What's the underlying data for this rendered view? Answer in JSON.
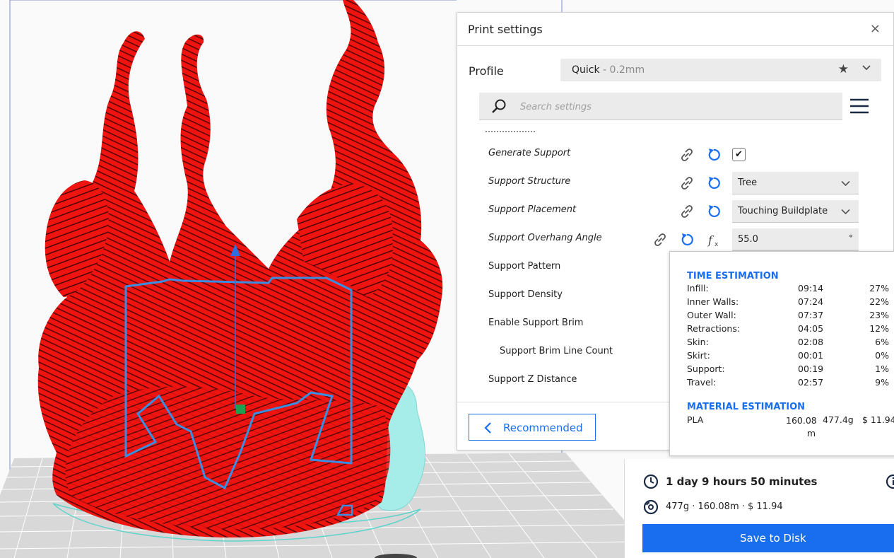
{
  "panel": {
    "title": "Print settings",
    "close_icon": "×",
    "profile_label": "Profile",
    "profile_name": "Quick",
    "profile_layer_height": " - 0.2mm",
    "search_placeholder": "Search settings",
    "settings": [
      {
        "label": "Generate Support",
        "italic": true,
        "control": "checkbox",
        "checked": true,
        "check_glyph": "✔"
      },
      {
        "label": "Support Structure",
        "italic": true,
        "control": "dropdown",
        "value": "Tree"
      },
      {
        "label": "Support Placement",
        "italic": true,
        "control": "dropdown",
        "value": "Touching Buildplate"
      },
      {
        "label": "Support Overhang Angle",
        "italic": true,
        "control": "number",
        "value": "55.0",
        "unit": "°"
      },
      {
        "label": "Support Pattern",
        "italic": false
      },
      {
        "label": "Support Density",
        "italic": false
      },
      {
        "label": "Enable Support Brim",
        "italic": false
      },
      {
        "label": "Support Brim Line Count",
        "italic": false,
        "indent": true
      },
      {
        "label": "Support Z Distance",
        "italic": false
      }
    ],
    "recommended_label": "Recommended"
  },
  "estimation": {
    "time_heading": "TIME ESTIMATION",
    "time_rows": [
      {
        "name": "Infill:",
        "time": "09:14",
        "pct": "27%"
      },
      {
        "name": "Inner Walls:",
        "time": "07:24",
        "pct": "22%"
      },
      {
        "name": "Outer Wall:",
        "time": "07:37",
        "pct": "23%"
      },
      {
        "name": "Retractions:",
        "time": "04:05",
        "pct": "12%"
      },
      {
        "name": "Skin:",
        "time": "02:08",
        "pct": "6%"
      },
      {
        "name": "Skirt:",
        "time": "00:01",
        "pct": "0%"
      },
      {
        "name": "Support:",
        "time": "00:19",
        "pct": "1%"
      },
      {
        "name": "Travel:",
        "time": "02:57",
        "pct": "9%"
      }
    ],
    "material_heading": "MATERIAL ESTIMATION",
    "material": {
      "name": "PLA",
      "length": "160.08 m",
      "weight": "477.4g",
      "cost": "$ 11.94"
    }
  },
  "summary": {
    "print_time": "1 day 9 hours 50 minutes",
    "material_summary": "477g · 160.08m · $ 11.94",
    "save_label": "Save to Disk"
  },
  "colors": {
    "accent": "#196ef0",
    "model": "#ef1410",
    "support": "#a6ece8",
    "selection": "#3a8de0"
  },
  "icons": {
    "close": "close-icon",
    "favorite": "star-icon",
    "search": "search-icon",
    "menu": "hamburger-menu-icon",
    "link": "link-icon",
    "reset": "reset-icon",
    "formula": "function-icon",
    "clock": "clock-icon",
    "spool": "spool-icon",
    "info": "info-icon"
  }
}
